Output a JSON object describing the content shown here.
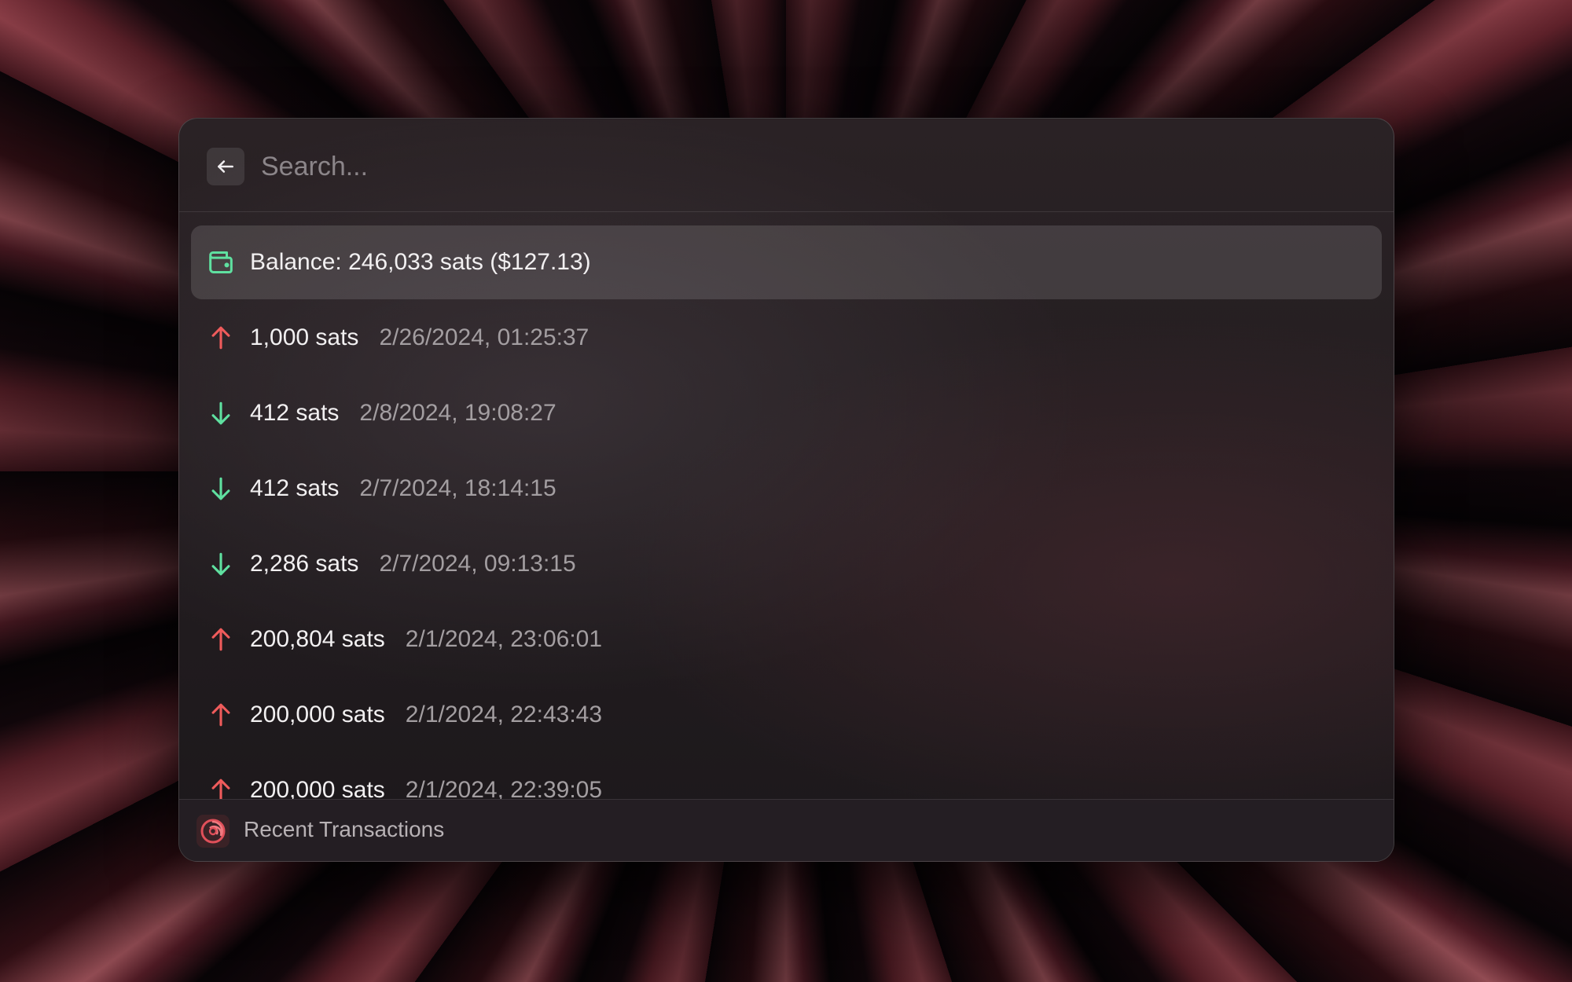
{
  "search": {
    "placeholder": "Search..."
  },
  "colors": {
    "send": "#ef5b5b",
    "receive": "#5fe0a0",
    "wallet": "#5fe0a0"
  },
  "balance": {
    "label": "Balance: 246,033 sats ($127.13)",
    "icon": "wallet-icon"
  },
  "transactions": [
    {
      "direction": "out",
      "icon": "arrow-up-icon",
      "amount": "1,000 sats",
      "date": "2/26/2024, 01:25:37"
    },
    {
      "direction": "in",
      "icon": "arrow-down-icon",
      "amount": "412 sats",
      "date": "2/8/2024, 19:08:27"
    },
    {
      "direction": "in",
      "icon": "arrow-down-icon",
      "amount": "412 sats",
      "date": "2/7/2024, 18:14:15"
    },
    {
      "direction": "in",
      "icon": "arrow-down-icon",
      "amount": "2,286 sats",
      "date": "2/7/2024, 09:13:15"
    },
    {
      "direction": "out",
      "icon": "arrow-up-icon",
      "amount": "200,804 sats",
      "date": "2/1/2024, 23:06:01"
    },
    {
      "direction": "out",
      "icon": "arrow-up-icon",
      "amount": "200,000 sats",
      "date": "2/1/2024, 22:43:43"
    },
    {
      "direction": "out",
      "icon": "arrow-up-icon",
      "amount": "200,000 sats",
      "date": "2/1/2024, 22:39:05"
    }
  ],
  "footer": {
    "title": "Recent Transactions",
    "logo": "app-logo-icon"
  }
}
